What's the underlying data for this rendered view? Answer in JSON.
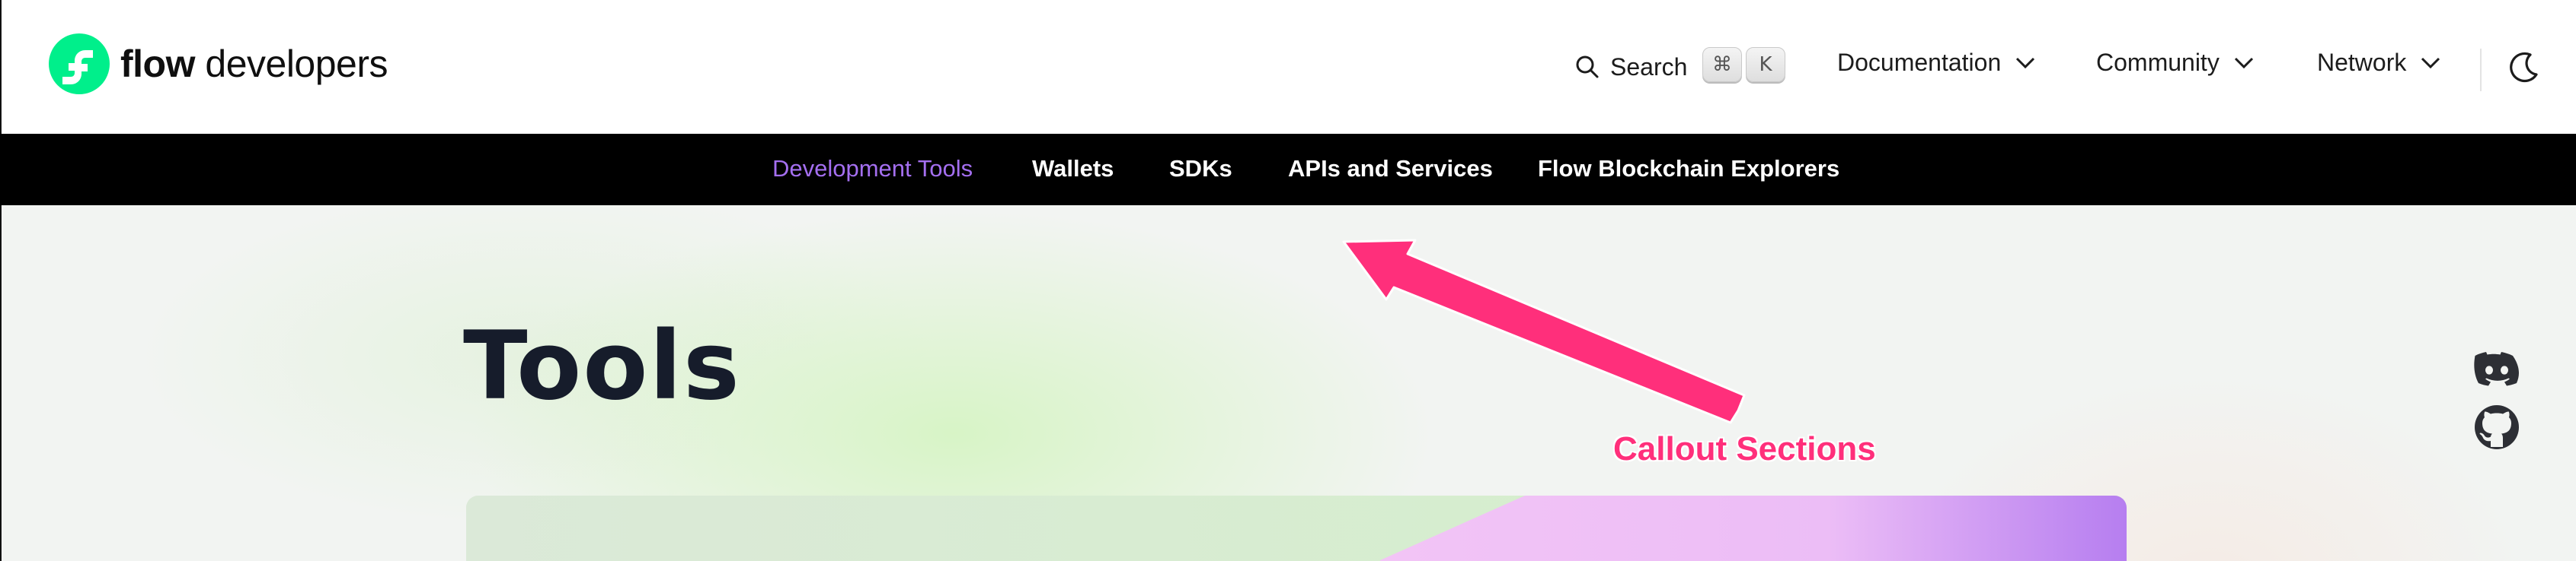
{
  "header": {
    "logo_bold": "flow",
    "logo_light": "developers",
    "search": {
      "label": "Search",
      "shortcut_mod": "⌘",
      "shortcut_key": "K"
    },
    "menu": [
      {
        "label": "Documentation"
      },
      {
        "label": "Community"
      },
      {
        "label": "Network"
      }
    ]
  },
  "subnav": {
    "items": [
      {
        "label": "Development Tools",
        "active": true
      },
      {
        "label": "Wallets",
        "active": false
      },
      {
        "label": "SDKs",
        "active": false
      },
      {
        "label": "APIs and Services",
        "active": false
      },
      {
        "label": "Flow Blockchain Explorers",
        "active": false
      }
    ]
  },
  "main": {
    "title": "Tools"
  },
  "annotation": {
    "label": "Callout Sections",
    "color": "#ff2f7b"
  },
  "colors": {
    "accent": "#a46ff0",
    "brand_green": "#00ef8b",
    "title": "#161c2b",
    "subnav_bg": "#000000"
  },
  "icons": [
    "flow-logo-icon",
    "search-icon",
    "chevron-down-icon",
    "moon-icon",
    "discord-icon",
    "github-icon",
    "arrow-annotation"
  ]
}
